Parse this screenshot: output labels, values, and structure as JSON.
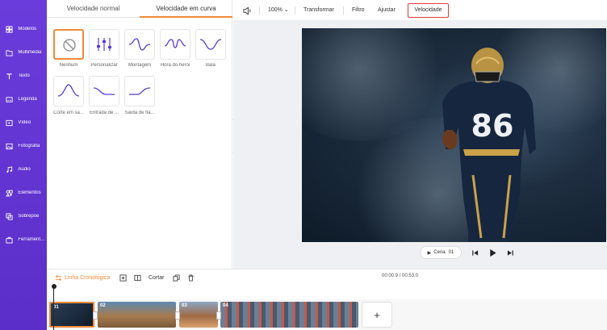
{
  "sidebar": {
    "items": [
      {
        "label": "Modelos",
        "icon": "template-icon"
      },
      {
        "label": "Multimédia",
        "icon": "media-icon"
      },
      {
        "label": "Texto",
        "icon": "text-icon"
      },
      {
        "label": "Legenda",
        "icon": "caption-icon"
      },
      {
        "label": "Vídeo",
        "icon": "video-icon"
      },
      {
        "label": "Fotografia",
        "icon": "photo-icon"
      },
      {
        "label": "Áudio",
        "icon": "audio-icon"
      },
      {
        "label": "Elementos",
        "icon": "elements-icon"
      },
      {
        "label": "Sobrepõe",
        "icon": "overlay-icon"
      },
      {
        "label": "Ferrament...",
        "icon": "tools-icon"
      }
    ]
  },
  "panel": {
    "tabs": [
      {
        "label": "Velocidade normal"
      },
      {
        "label": "Velocidade em curva"
      }
    ],
    "presets": [
      {
        "label": "Nenhum"
      },
      {
        "label": "Personalizar"
      },
      {
        "label": "Montagem"
      },
      {
        "label": "Hora do herói"
      },
      {
        "label": "Bala"
      },
      {
        "label": "Corte em sa..."
      },
      {
        "label": "Entrada de ..."
      },
      {
        "label": "Saída de fla..."
      }
    ]
  },
  "toolbar": {
    "zoom": "100%",
    "transform": "Transformar",
    "filter": "Filtro",
    "adjust": "Ajustar",
    "speed": "Velocidade"
  },
  "player": {
    "scene_label": "Cena",
    "scene_number": "01",
    "jersey_number": "86"
  },
  "timeline": {
    "label": "Linha Cronológica",
    "cut": "Cortar",
    "time": "00:00.9 / 00:53.0",
    "clips": [
      {
        "num": "01"
      },
      {
        "num": "02"
      },
      {
        "num": "03"
      },
      {
        "num": "04"
      }
    ],
    "add": "+"
  },
  "colors": {
    "sidebar": "#5b2ec9",
    "accent": "#f08a38",
    "active_outline": "#e23b3b",
    "curve": "#5b3bd6"
  }
}
